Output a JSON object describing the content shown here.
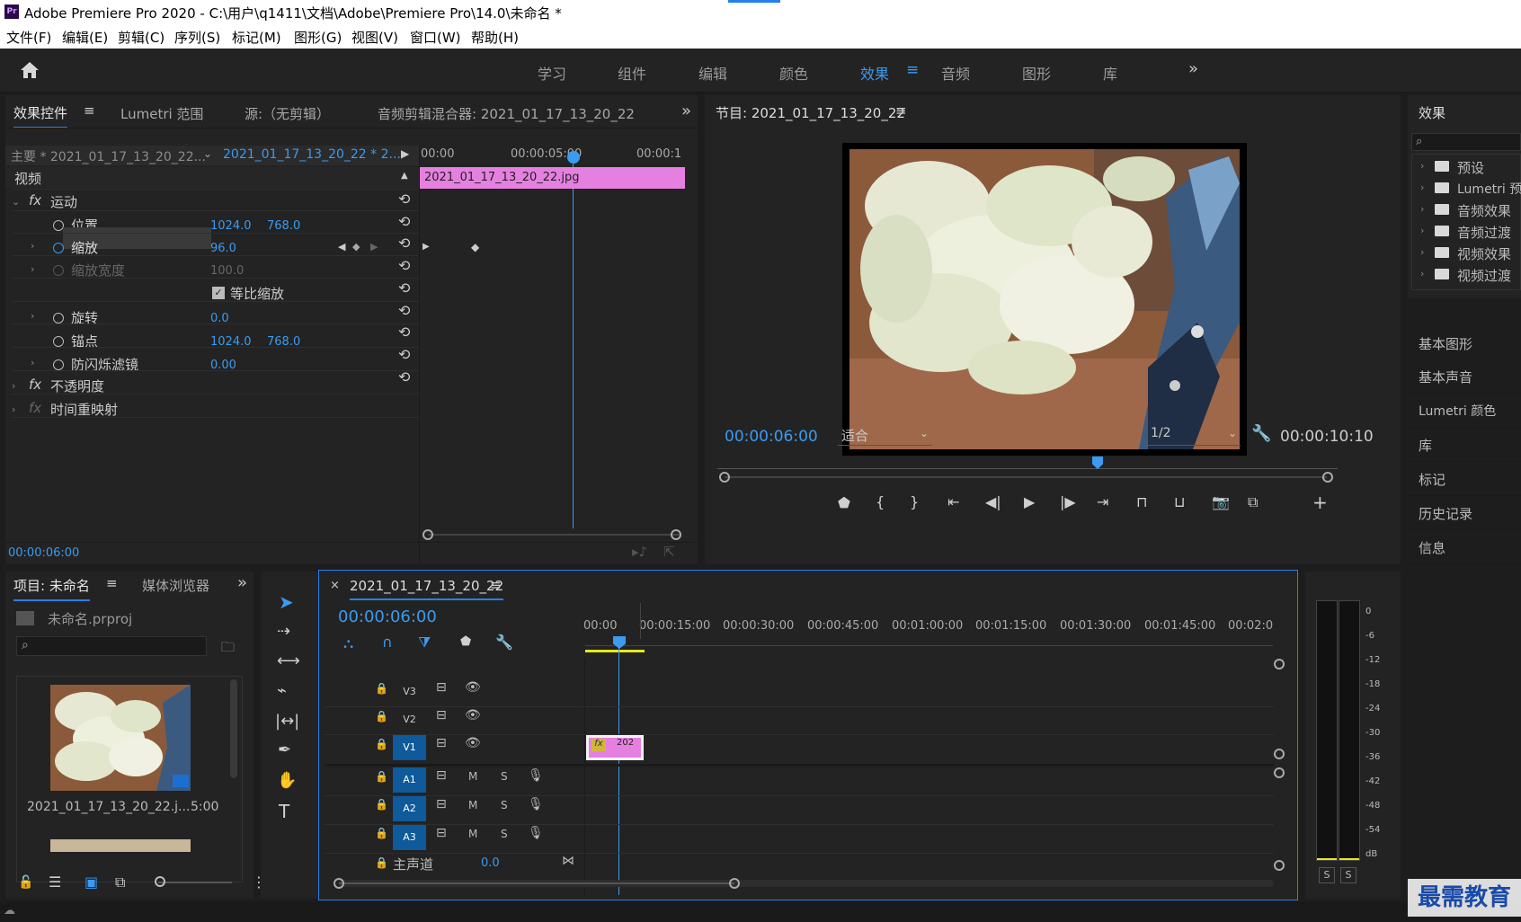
{
  "window": {
    "app_icon": "Pr",
    "title": "Adobe Premiere Pro 2020 - C:\\用户\\q1411\\文档\\Adobe\\Premiere Pro\\14.0\\未命名 *"
  },
  "menu": [
    "文件(F)",
    "编辑(E)",
    "剪辑(C)",
    "序列(S)",
    "标记(M)",
    "图形(G)",
    "视图(V)",
    "窗口(W)",
    "帮助(H)"
  ],
  "workspaces": [
    "学习",
    "组件",
    "编辑",
    "颜色",
    "效果",
    "音频",
    "图形",
    "库"
  ],
  "workspace_active": "效果",
  "effect_controls": {
    "tabs": [
      "效果控件",
      "Lumetri 范围",
      "源:（无剪辑）",
      "音频剪辑混合器: 2021_01_17_13_20_22"
    ],
    "master": "主要 * 2021_01_17_13_20_22...",
    "clip": "2021_01_17_13_20_22 * 2...",
    "ruler": [
      "00:00",
      "00:00:05:00",
      "00:00:1"
    ],
    "clip_bar": "2021_01_17_13_20_22.jpg",
    "section": "视频",
    "motion": "运动",
    "position_label": "位置",
    "position_x": "1024.0",
    "position_y": "768.0",
    "scale_label": "缩放",
    "scale_value": "96.0",
    "scale_width_label": "缩放宽度",
    "scale_width_value": "100.0",
    "uniform_label": "等比缩放",
    "rotation_label": "旋转",
    "rotation_value": "0.0",
    "anchor_label": "锚点",
    "anchor_x": "1024.0",
    "anchor_y": "768.0",
    "flicker_label": "防闪烁滤镜",
    "flicker_value": "0.00",
    "opacity": "不透明度",
    "time_remap": "时间重映射",
    "timecode": "00:00:06:00"
  },
  "program": {
    "title": "节目: 2021_01_17_13_20_22",
    "timecode": "00:00:06:00",
    "fit": "适合",
    "resolution": "1/2",
    "duration": "00:00:10:10"
  },
  "effects_panel": {
    "title": "效果",
    "items": [
      "预设",
      "Lumetri 预设",
      "音频效果",
      "音频过渡",
      "视频效果",
      "视频过渡"
    ],
    "panels": [
      "基本图形",
      "基本声音",
      "Lumetri 颜色",
      "库",
      "标记",
      "历史记录",
      "信息"
    ]
  },
  "project": {
    "tabs": [
      "项目: 未命名",
      "媒体浏览器"
    ],
    "file": "未命名.prproj",
    "thumb_name": "2021_01_17_13_20_22.j...",
    "thumb_duration": "5:00"
  },
  "timeline": {
    "tab": "2021_01_17_13_20_22",
    "timecode": "00:00:06:00",
    "ruler": [
      "00:00",
      "00:00:15:00",
      "00:00:30:00",
      "00:00:45:00",
      "00:01:00:00",
      "00:01:15:00",
      "00:01:30:00",
      "00:01:45:00",
      "00:02:0"
    ],
    "video_tracks": [
      "V3",
      "V2",
      "V1"
    ],
    "audio_tracks": [
      "A1",
      "A2",
      "A3"
    ],
    "master": "主声道",
    "master_value": "0.0",
    "clip_label": "202"
  },
  "meter": {
    "labels": [
      "0",
      "-6",
      "-12",
      "-18",
      "-24",
      "-30",
      "-36",
      "-42",
      "-48",
      "-54",
      "dB"
    ],
    "solo": [
      "S",
      "S"
    ]
  },
  "watermark": "最需教育"
}
